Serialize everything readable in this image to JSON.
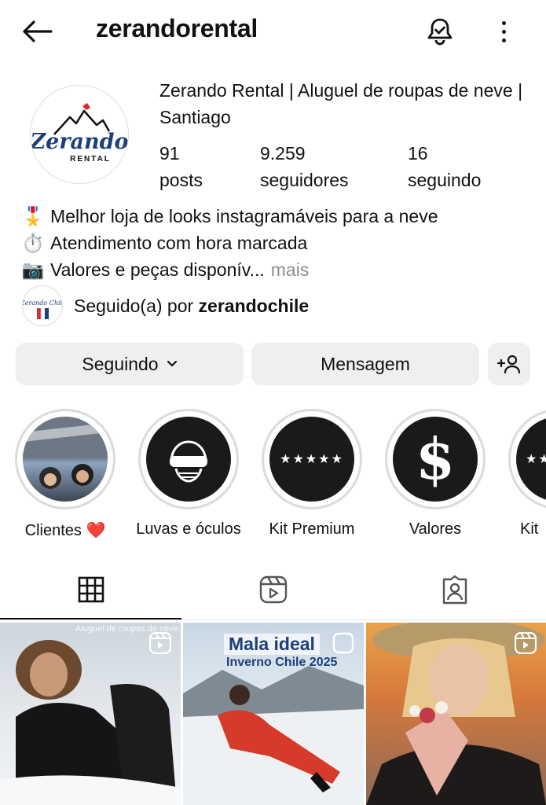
{
  "header": {
    "username": "zerandorental"
  },
  "profile": {
    "avatar_text": "Zerando",
    "avatar_subtext": "RENTAL",
    "full_name": "Zerando Rental | Aluguel de roupas de neve | Santiago",
    "stats": {
      "posts": {
        "value": "91",
        "label": "posts"
      },
      "followers": {
        "value": "9.259",
        "label": "seguidores"
      },
      "following": {
        "value": "16",
        "label": "seguindo"
      }
    },
    "bio": [
      {
        "emoji": "🎖️",
        "text": "Melhor loja de looks instagramáveis para a neve"
      },
      {
        "emoji": "⏱️",
        "text": "Atendimento com hora marcada"
      },
      {
        "emoji": "📷",
        "text": "Valores e peças disponív..."
      }
    ],
    "bio_more": "mais",
    "followed_by_prefix": "Seguido(a) por",
    "followed_by_name": "zerandochile",
    "followed_by_avatar_text": "Zerando Chile"
  },
  "buttons": {
    "following": "Seguindo",
    "message": "Mensagem"
  },
  "highlights": [
    {
      "label": "Clientes ❤️",
      "kind": "photo"
    },
    {
      "label": "Luvas e óculos",
      "kind": "helmet-icon"
    },
    {
      "label": "Kit Premium",
      "kind": "stars-icon",
      "stars": "★★★★★"
    },
    {
      "label": "Valores",
      "kind": "dollar-icon",
      "symbol": "$"
    },
    {
      "label": "Kit",
      "kind": "stars-icon",
      "stars": "★★"
    }
  ],
  "tabs": [
    "grid",
    "reels",
    "tagged"
  ],
  "grid_posts": [
    {
      "caption": "Aluguel de roupas de neve",
      "type": "reel"
    },
    {
      "title": "Mala ideal",
      "subtitle": "Inverno Chile 2025",
      "type": "reel"
    },
    {
      "type": "reel"
    }
  ],
  "colors": {
    "button_bg": "#efefef",
    "muted_text": "#8e8e8e",
    "brand_blue": "#1d3f7a",
    "brand_red": "#d62b2b"
  }
}
